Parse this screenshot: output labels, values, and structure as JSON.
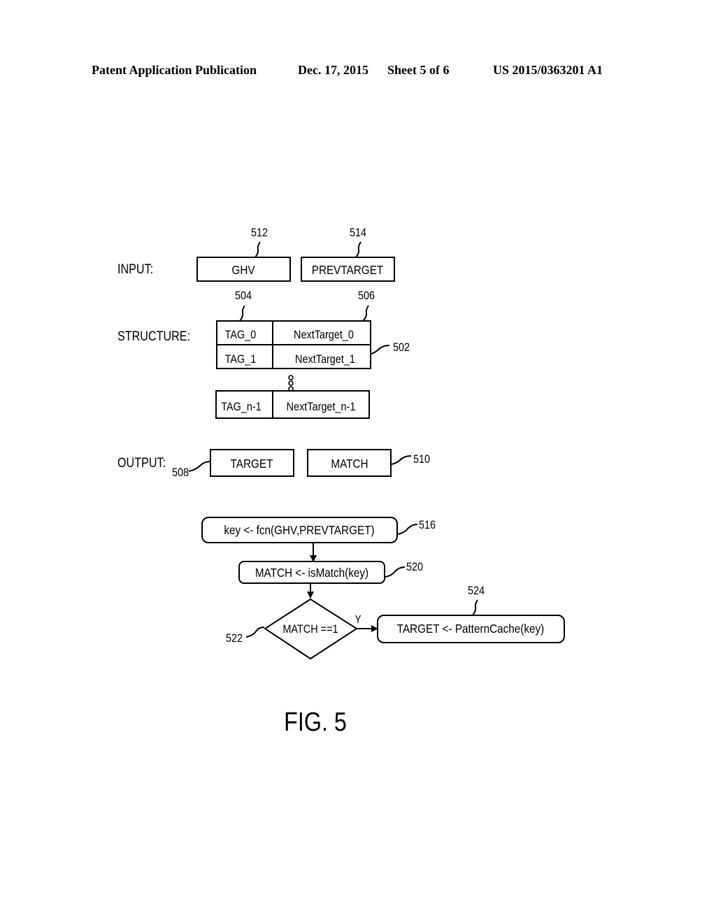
{
  "header": {
    "publication": "Patent Application Publication",
    "date": "Dec. 17, 2015",
    "sheet": "Sheet 5 of 6",
    "number": "US 2015/0363201 A1"
  },
  "labels": {
    "input": "INPUT:",
    "structure": "STRUCTURE:",
    "output": "OUTPUT:"
  },
  "input": {
    "ghv": {
      "text": "GHV",
      "ref": "512"
    },
    "prevtarget": {
      "text": "PREVTARGET",
      "ref": "514"
    }
  },
  "structure": {
    "ref": "502",
    "tag_col_ref": "504",
    "target_col_ref": "506",
    "rows": [
      {
        "tag": "TAG_0",
        "target": "NextTarget_0"
      },
      {
        "tag": "TAG_1",
        "target": "NextTarget_1"
      },
      {
        "tag": "TAG_n-1",
        "target": "NextTarget_n-1"
      }
    ]
  },
  "output": {
    "target": {
      "text": "TARGET",
      "ref": "508"
    },
    "match": {
      "text": "MATCH",
      "ref": "510"
    }
  },
  "flow": {
    "key": {
      "text": "key <- fcn(GHV,PREVTARGET)",
      "ref": "516"
    },
    "ismatch": {
      "text": "MATCH <- isMatch(key)",
      "ref": "520"
    },
    "decision": {
      "text": "MATCH ==1",
      "ref": "522",
      "yes": "Y"
    },
    "lookup": {
      "text": "TARGET <- PatternCache(key)",
      "ref": "524"
    }
  },
  "figure_label": "FIG. 5"
}
